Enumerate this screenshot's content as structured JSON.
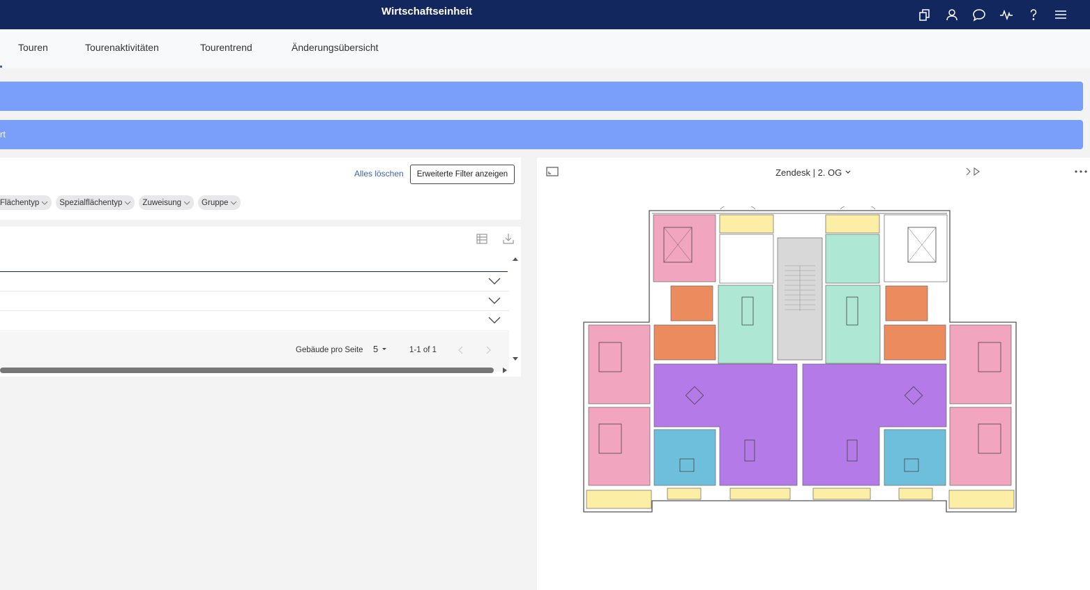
{
  "header": {
    "title": "Wirtschaftseinheit",
    "icons": [
      "copy-icon",
      "user-icon",
      "chat-icon",
      "activity-icon",
      "help-icon",
      "menu-icon"
    ]
  },
  "tabs": [
    {
      "label": "Touren"
    },
    {
      "label": "Tourenaktivitäten"
    },
    {
      "label": "Tourentrend"
    },
    {
      "label": "Änderungsübersicht"
    }
  ],
  "banners": {
    "first": "",
    "second": "rt"
  },
  "filters": {
    "clear_all": "Alles löschen",
    "advanced": "Erweiterte Filter anzeigen",
    "chips": [
      "Flächentyp",
      "Spezialflächentyp",
      "Zuweisung",
      "Gruppe"
    ]
  },
  "table": {
    "rows": 3,
    "footer": {
      "per_page_label": "Gebäude pro Seite",
      "per_page_value": "5",
      "range": "1-1 of 1"
    }
  },
  "viewer": {
    "building": "Zendesk",
    "floor": "2. OG",
    "title": "Zendesk | 2. OG"
  },
  "colors": {
    "nav": "#12275d",
    "banner": "#7a9ffb",
    "bedroom": "#f2a5bf",
    "bath": "#ec8b5e",
    "kitchen": "#aee8d4",
    "living": "#b47ae8",
    "office": "#6ebfdb",
    "balcony": "#fcefa5",
    "stairs": "#d8d8d8"
  }
}
